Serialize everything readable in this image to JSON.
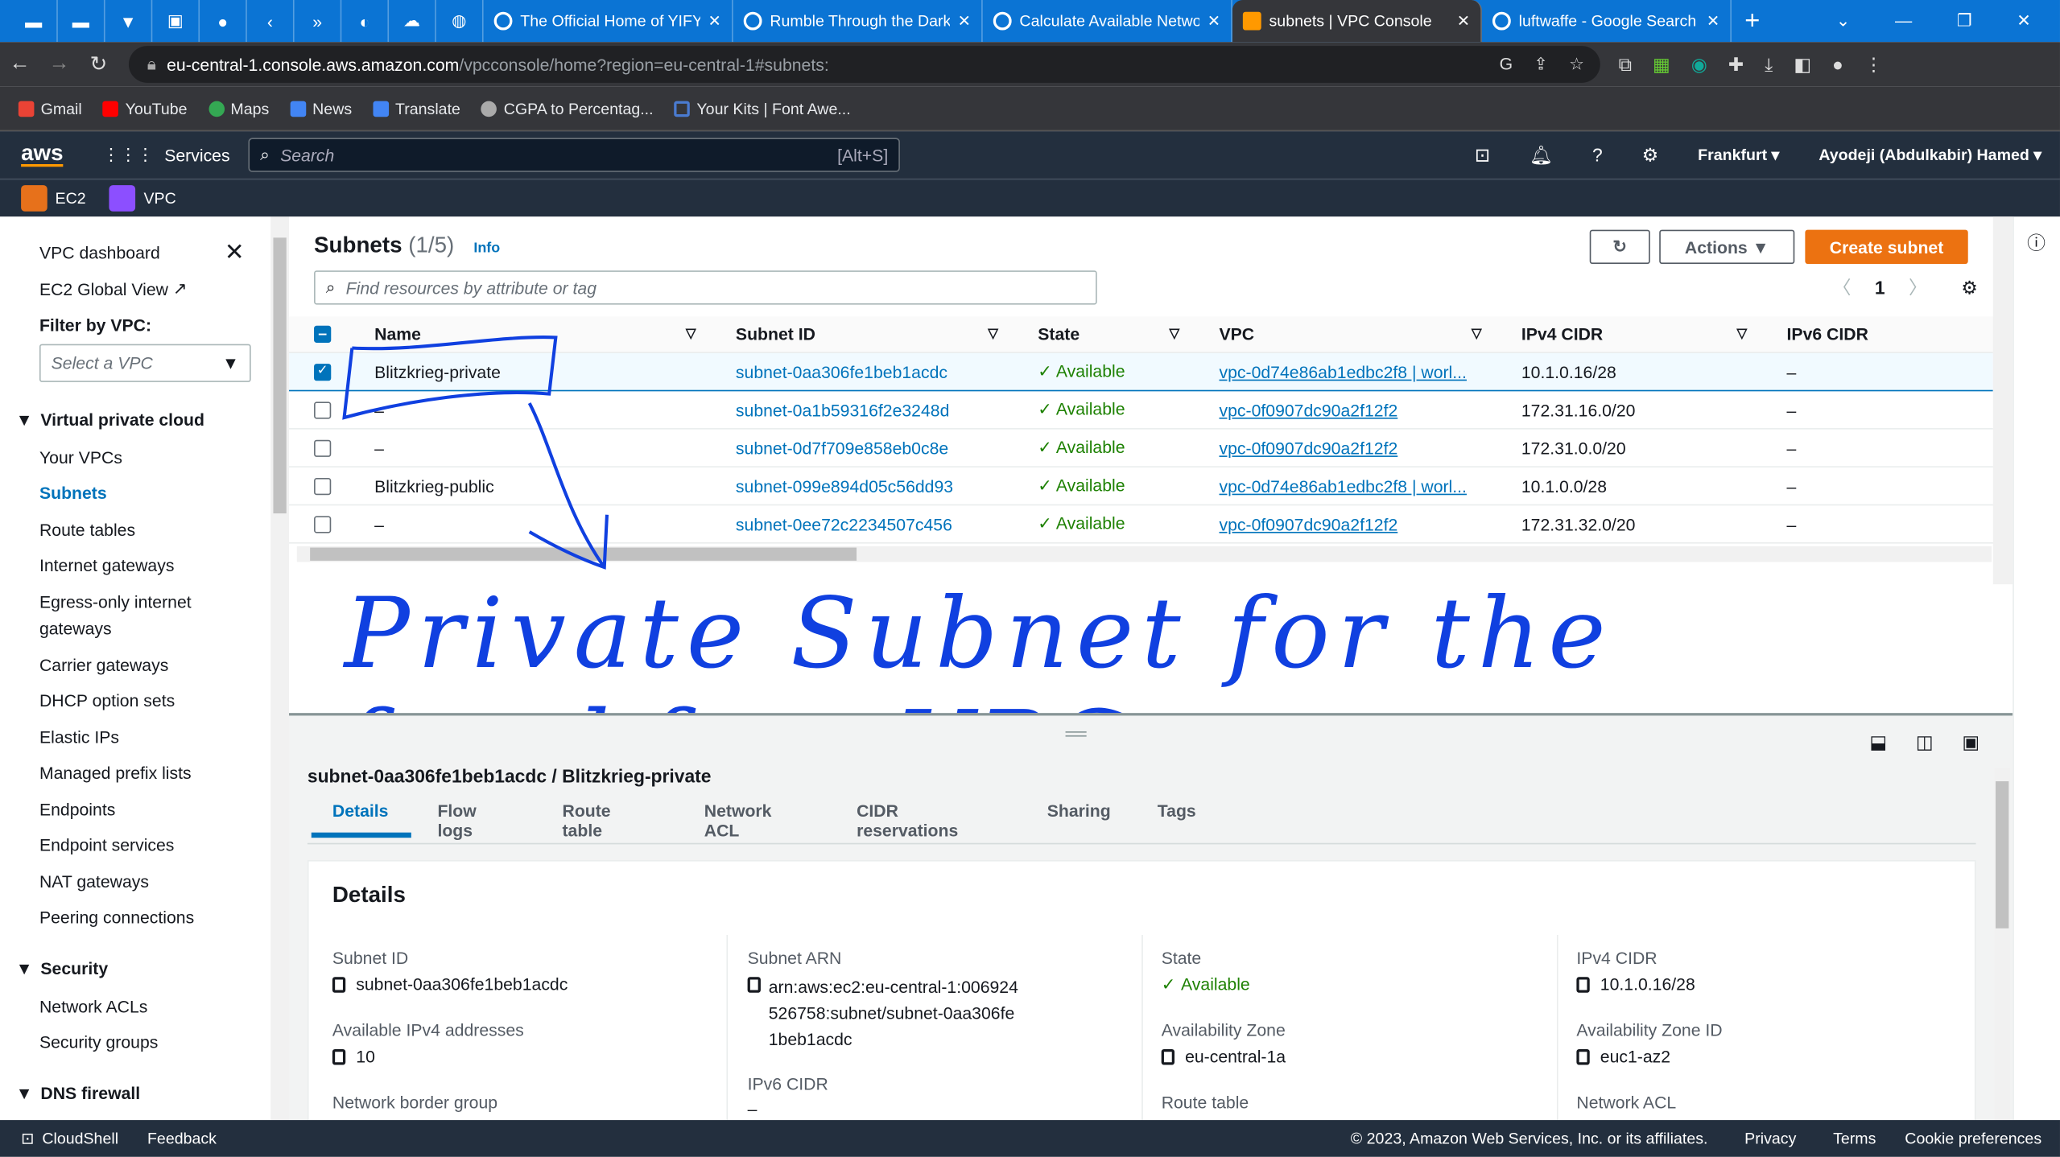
{
  "browser": {
    "tabs": [
      {
        "label": "The Official Home of YIFY",
        "active": false
      },
      {
        "label": "Rumble Through the Dark",
        "active": false
      },
      {
        "label": "Calculate Available Netwo",
        "active": false
      },
      {
        "label": "subnets | VPC Console",
        "active": true
      },
      {
        "label": "luftwaffe - Google Search",
        "active": false
      }
    ],
    "url_host": "eu-central-1.console.aws.amazon.com",
    "url_path": "/vpcconsole/home?region=eu-central-1#subnets:",
    "bookmarks": [
      "Gmail",
      "YouTube",
      "Maps",
      "News",
      "Translate",
      "CGPA to Percentag...",
      "Your Kits | Font Awe..."
    ]
  },
  "aws": {
    "logo": "aws",
    "services": "Services",
    "search_placeholder": "Search",
    "search_shortcut": "[Alt+S]",
    "region": "Frankfurt",
    "user": "Ayodeji (Abdulkabir) Hamed",
    "favorites": [
      "EC2",
      "VPC"
    ]
  },
  "sidebar": {
    "top": [
      "VPC dashboard",
      "EC2 Global View"
    ],
    "filter_label": "Filter by VPC:",
    "filter_placeholder": "Select a VPC",
    "sections": [
      {
        "title": "Virtual private cloud",
        "items": [
          "Your VPCs",
          "Subnets",
          "Route tables",
          "Internet gateways",
          "Egress-only internet gateways",
          "Carrier gateways",
          "DHCP option sets",
          "Elastic IPs",
          "Managed prefix lists",
          "Endpoints",
          "Endpoint services",
          "NAT gateways",
          "Peering connections"
        ]
      },
      {
        "title": "Security",
        "items": [
          "Network ACLs",
          "Security groups"
        ]
      },
      {
        "title": "DNS firewall",
        "items": []
      }
    ],
    "active": "Subnets"
  },
  "subnets": {
    "title": "Subnets",
    "count": "(1/5)",
    "info": "Info",
    "actions": "Actions",
    "create": "Create subnet",
    "filter_placeholder": "Find resources by attribute or tag",
    "page": "1",
    "columns": [
      "Name",
      "Subnet ID",
      "State",
      "VPC",
      "IPv4 CIDR",
      "IPv6 CIDR"
    ],
    "rows": [
      {
        "selected": true,
        "name": "Blitzkrieg-private",
        "id": "subnet-0aa306fe1beb1acdc",
        "state": "Available",
        "vpc": "vpc-0d74e86ab1edbc2f8 | worl...",
        "ipv4": "10.1.0.16/28",
        "ipv6": "–"
      },
      {
        "selected": false,
        "name": "–",
        "id": "subnet-0a1b59316f2e3248d",
        "state": "Available",
        "vpc": "vpc-0f0907dc90a2f12f2",
        "ipv4": "172.31.16.0/20",
        "ipv6": "–"
      },
      {
        "selected": false,
        "name": "–",
        "id": "subnet-0d7f709e858eb0c8e",
        "state": "Available",
        "vpc": "vpc-0f0907dc90a2f12f2",
        "ipv4": "172.31.0.0/20",
        "ipv6": "–"
      },
      {
        "selected": false,
        "name": "Blitzkrieg-public",
        "id": "subnet-099e894d05c56dd93",
        "state": "Available",
        "vpc": "vpc-0d74e86ab1edbc2f8 | worl...",
        "ipv4": "10.1.0.0/28",
        "ipv6": "–"
      },
      {
        "selected": false,
        "name": "–",
        "id": "subnet-0ee72c2234507c456",
        "state": "Available",
        "vpc": "vpc-0f0907dc90a2f12f2",
        "ipv4": "172.31.32.0/20",
        "ipv6": "–"
      }
    ]
  },
  "annotation": {
    "text": "Private Subnet for the frankfurt VPC",
    "color": "#1040e0"
  },
  "detail": {
    "heading": "subnet-0aa306fe1beb1acdc / Blitzkrieg-private",
    "tabs": [
      "Details",
      "Flow logs",
      "Route table",
      "Network ACL",
      "CIDR reservations",
      "Sharing",
      "Tags"
    ],
    "section": "Details",
    "fields": [
      {
        "label": "Subnet ID",
        "value": "subnet-0aa306fe1beb1acdc"
      },
      {
        "label": "Subnet ARN",
        "value": "arn:aws:ec2:eu-central-1:006924526758:subnet/subnet-0aa306fe1beb1acdc"
      },
      {
        "label": "State",
        "value": "Available"
      },
      {
        "label": "IPv4 CIDR",
        "value": "10.1.0.16/28"
      },
      {
        "label": "Available IPv4 addresses",
        "value": "10"
      },
      {
        "label": "Availability Zone",
        "value": "eu-central-1a"
      },
      {
        "label": "Availability Zone ID",
        "value": "euc1-az2"
      },
      {
        "label": "IPv6 CIDR",
        "value": "–"
      },
      {
        "label": "Network border group",
        "value": ""
      },
      {
        "label": "Route table",
        "value": ""
      },
      {
        "label": "Network ACL",
        "value": ""
      }
    ]
  },
  "footer": {
    "cloudshell": "CloudShell",
    "feedback": "Feedback",
    "copyright": "© 2023, Amazon Web Services, Inc. or its affiliates.",
    "links": [
      "Privacy",
      "Terms",
      "Cookie preferences"
    ]
  }
}
